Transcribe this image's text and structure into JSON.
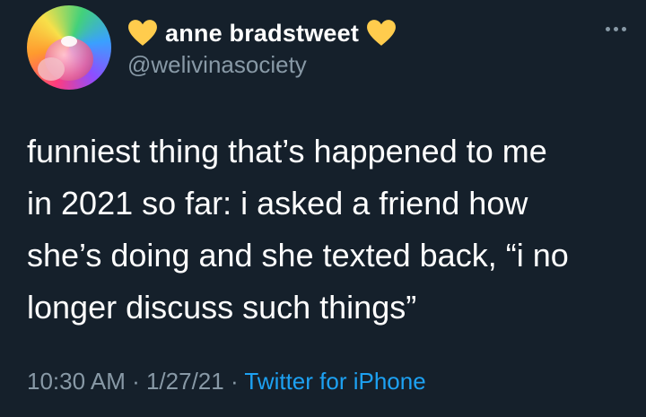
{
  "author": {
    "display_name": "anne bradstweet",
    "handle": "@welivinasociety",
    "name_emoji": "yellow-heart-icon"
  },
  "tweet": {
    "lines": [
      "funniest thing that’s happened to me",
      "in 2021 so far: i asked a friend how",
      "she’s doing and she texted back, “i no",
      "longer discuss such things”"
    ]
  },
  "meta": {
    "time": "10:30 AM",
    "separator": " · ",
    "date": "1/27/21",
    "source": "Twitter for iPhone"
  },
  "colors": {
    "background": "#15202b",
    "text": "#ffffff",
    "muted": "#8899a6",
    "link": "#1da1f2",
    "heart": "#ffcc4d"
  }
}
